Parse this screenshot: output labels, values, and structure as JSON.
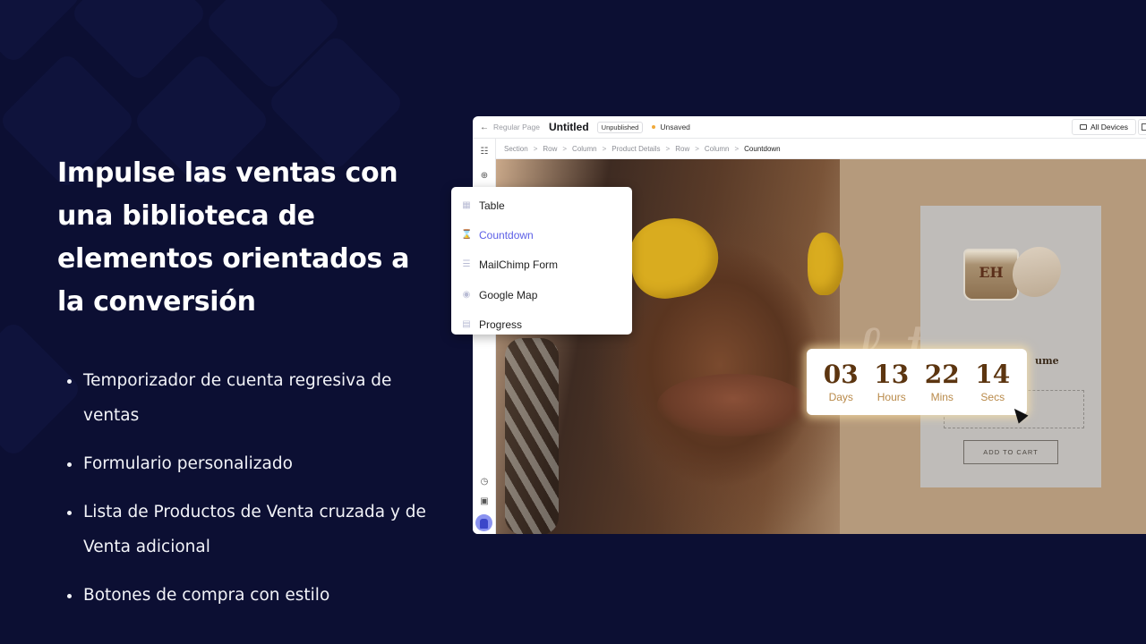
{
  "marketing": {
    "headline": "Impulse las ventas con una biblioteca de elementos orientados a la conversión",
    "bullets": [
      "Temporizador de cuenta regresiva de ventas",
      "Formulario personalizado",
      "Lista de Productos de Venta cruzada y de Venta adicional",
      "Botones de compra con estilo"
    ]
  },
  "editor": {
    "topbar": {
      "back_icon": "arrow-left-icon",
      "page_type": "Regular Page",
      "title": "Untitled",
      "status_badge": "Unpublished",
      "save_status": "Unsaved",
      "devices_button": "All Devices"
    },
    "breadcrumb": [
      "Section",
      "Row",
      "Column",
      "Product Details",
      "Row",
      "Column",
      "Countdown"
    ],
    "sidebar_icons": [
      "sitemap-icon",
      "add-circle-icon",
      "history-icon",
      "terminal-icon",
      "avatar"
    ],
    "element_menu": [
      {
        "label": "Table",
        "icon": "table-icon",
        "active": false
      },
      {
        "label": "Countdown",
        "icon": "hourglass-icon",
        "active": true
      },
      {
        "label": "MailChimp Form",
        "icon": "list-icon",
        "active": false
      },
      {
        "label": "Google Map",
        "icon": "map-pin-icon",
        "active": false
      },
      {
        "label": "Progress",
        "icon": "progress-icon",
        "active": false
      }
    ],
    "countdown": [
      {
        "value": "03",
        "label": "Days"
      },
      {
        "value": "13",
        "label": "Hours"
      },
      {
        "value": "22",
        "label": "Mins"
      },
      {
        "value": "14",
        "label": "Secs"
      }
    ],
    "product": {
      "jar_label": "EH",
      "name_fragment": "ume",
      "add_to_cart": "ADD TO CART"
    },
    "colors": {
      "accent": "#5b5ee6",
      "countdown_number": "#5c3510",
      "countdown_label": "#b98a4a",
      "unsaved_dot": "#f0a93a",
      "background": "#0c0f33"
    }
  }
}
